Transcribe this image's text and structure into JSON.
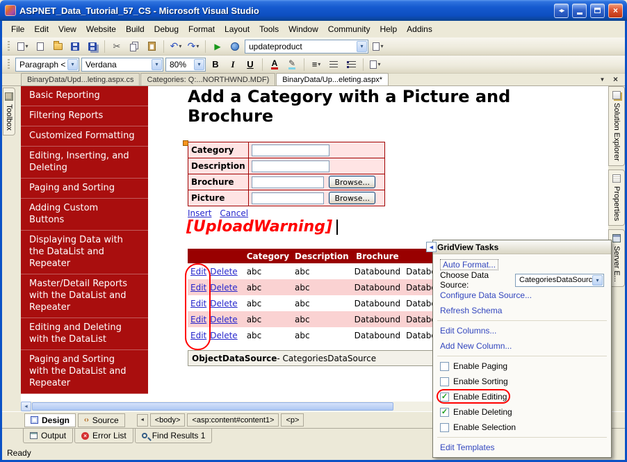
{
  "window": {
    "title": "ASPNET_Data_Tutorial_57_CS - Microsoft Visual Studio",
    "status_ready": "Ready"
  },
  "icons": {
    "dropdown": "▾",
    "window_pair": "◀▶",
    "close": "×",
    "cut": "✂",
    "undo": "↶",
    "redo": "↷",
    "play": "▶",
    "pencil": "✎",
    "align": "≡",
    "tab_menu": "▼",
    "tab_close": "×",
    "scroll_left": "◄",
    "scroll_right": "►",
    "nav_less": "◄",
    "smart_tag": "◀",
    "check": "✓",
    "error_x": "×",
    "source_tags": "‹›"
  },
  "menu": {
    "items": [
      "File",
      "Edit",
      "View",
      "Website",
      "Build",
      "Debug",
      "Format",
      "Layout",
      "Tools",
      "Window",
      "Community",
      "Help",
      "Addins"
    ]
  },
  "toolbar": {
    "command_combo": "updateproduct"
  },
  "format_toolbar": {
    "block": "Paragraph <",
    "font": "Verdana",
    "size": "80%",
    "bold": "B",
    "italic": "I",
    "underline": "U",
    "color_a": "A"
  },
  "doc_tabs": [
    {
      "label": "BinaryData/Upd...leting.aspx.cs"
    },
    {
      "label": "Categories: Q:...NORTHWND.MDF)"
    },
    {
      "label": "BinaryData/Up...eleting.aspx*"
    }
  ],
  "toolbox": {
    "label": "Toolbox"
  },
  "nav_menu": {
    "items": [
      "Basic Reporting",
      "Filtering Reports",
      "Customized Formatting",
      "Editing, Inserting, and Deleting",
      "Paging and Sorting",
      "Adding Custom Buttons",
      "Displaying Data with the DataList and Repeater",
      "Master/Detail Reports with the DataList and Repeater",
      "Editing and Deleting with the DataList",
      "Paging and Sorting with the DataList and Repeater"
    ]
  },
  "design": {
    "heading": "Add a Category with a Picture and Brochure",
    "form": {
      "rows": [
        {
          "label": "Category"
        },
        {
          "label": "Description"
        },
        {
          "label": "Brochure"
        },
        {
          "label": "Picture"
        }
      ],
      "browse_label": "Browse...",
      "insert": "Insert",
      "cancel": "Cancel"
    },
    "upload_warning": "[UploadWarning]",
    "grid": {
      "headers": [
        "",
        "Category",
        "Description",
        "Brochure",
        ""
      ],
      "rows": [
        [
          "Edit",
          "Delete",
          "abc",
          "abc",
          "Databound",
          "Databound"
        ],
        [
          "Edit",
          "Delete",
          "abc",
          "abc",
          "Databound",
          "Databound"
        ],
        [
          "Edit",
          "Delete",
          "abc",
          "abc",
          "Databound",
          "Databound"
        ],
        [
          "Edit",
          "Delete",
          "abc",
          "abc",
          "Databound",
          "Databound"
        ],
        [
          "Edit",
          "Delete",
          "abc",
          "abc",
          "Databound",
          "Databound"
        ]
      ]
    },
    "datasource": {
      "bold": "ObjectDataSource",
      "rest": " - CategoriesDataSource"
    }
  },
  "tasks": {
    "title": "GridView Tasks",
    "auto_format": "Auto Format...",
    "choose_label": "Choose Data Source:",
    "choose_value": "CategoriesDataSource",
    "configure": "Configure Data Source...",
    "refresh": "Refresh Schema",
    "edit_columns": "Edit Columns...",
    "add_column": "Add New Column...",
    "checkboxes": [
      {
        "label": "Enable Paging",
        "checked": false
      },
      {
        "label": "Enable Sorting",
        "checked": false
      },
      {
        "label": "Enable Editing",
        "checked": true
      },
      {
        "label": "Enable Deleting",
        "checked": true
      },
      {
        "label": "Enable Selection",
        "checked": false
      }
    ],
    "edit_templates": "Edit Templates"
  },
  "side_tabs": {
    "items": [
      "Solution Explorer",
      "Properties",
      "Server E..."
    ]
  },
  "view_bar": {
    "design": "Design",
    "source": "Source",
    "chips": [
      "<body>",
      "<asp:content#content1>",
      "<p>"
    ]
  },
  "bottom_panels": {
    "tabs": [
      "Output",
      "Error List",
      "Find Results 1"
    ]
  },
  "colors": {
    "nav_red": "#A90E0E",
    "grid_header_red": "#990000",
    "alt_row_pink": "#FAD2D2",
    "annotation_red": "#FF0000",
    "titlebar_blue": "#0D4EC0"
  }
}
